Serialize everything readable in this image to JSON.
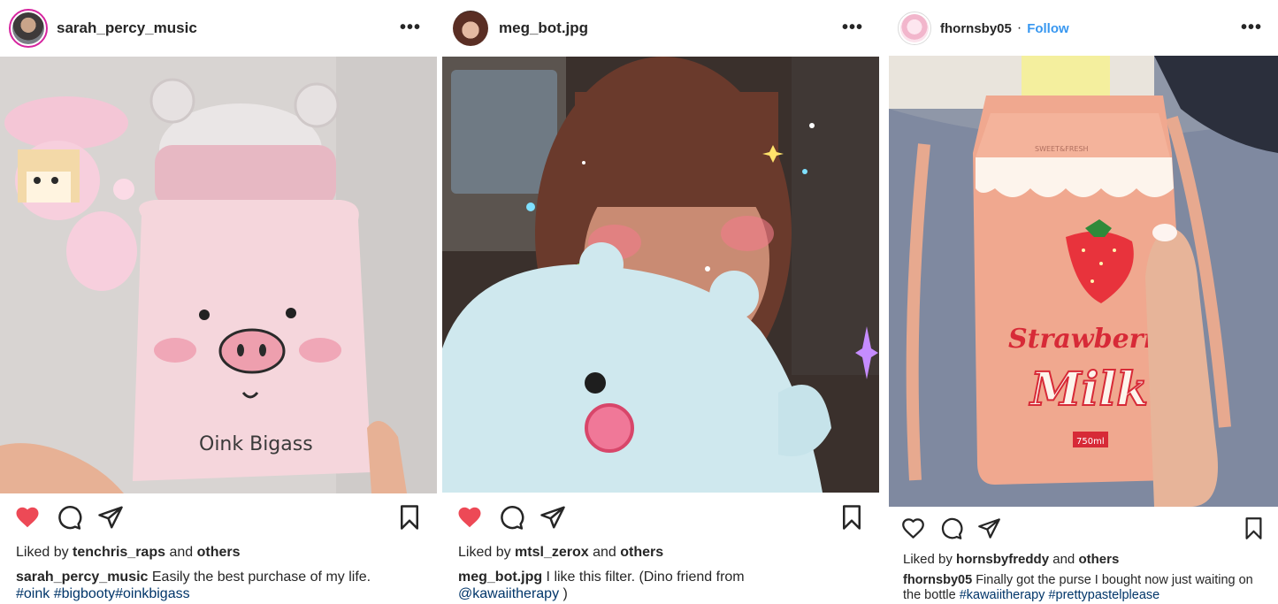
{
  "posts": [
    {
      "username": "sarah_percy_music",
      "more_label": "•••",
      "image_text": "Oink Bigass",
      "liked_prefix": "Liked by",
      "liked_user": "tenchris_raps",
      "liked_and": "and",
      "liked_others": "others",
      "caption_user": "sarah_percy_music",
      "caption_text": " Easily the best purchase of my life.",
      "caption_tags": "#oink #bigbooty#oinkbigass",
      "liked": true
    },
    {
      "username": "meg_bot.jpg",
      "more_label": "•••",
      "liked_prefix": "Liked by",
      "liked_user": "mtsl_zerox",
      "liked_and": "and",
      "liked_others": "others",
      "caption_user": "meg_bot.jpg",
      "caption_text": " I like this filter. (Dino friend from",
      "caption_tag": "@kawaiitherapy",
      "caption_end": " )",
      "liked": true
    },
    {
      "username": "fhornsby05",
      "separator": "·",
      "follow_label": "Follow",
      "more_label": "•••",
      "image_text_top": "SWEET&FRESH",
      "image_text_1": "Strawberry",
      "image_text_2": "Milk",
      "image_text_3": "750ml",
      "liked_prefix": "Liked by",
      "liked_user": "hornsbyfreddy",
      "liked_and": "and",
      "liked_others": "others",
      "caption_user": "fhornsby05",
      "caption_text": " Finally got the purse I bought now just waiting on the bottle ",
      "caption_tag_1": "#kawaiitherapy",
      "caption_tag_2": " #prettypastelplease",
      "liked": false
    }
  ],
  "colors": {
    "heart_liked": "#ed4956",
    "link": "#003569",
    "follow": "#3897f0"
  },
  "icons": [
    "heart-icon",
    "comment-icon",
    "share-icon",
    "bookmark-icon",
    "more-icon"
  ]
}
